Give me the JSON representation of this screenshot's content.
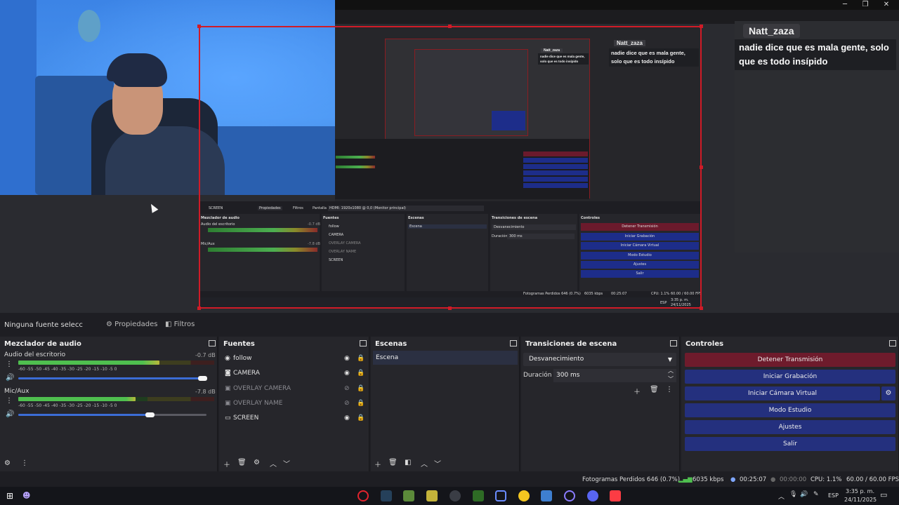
{
  "window_controls": {
    "minimize": "─",
    "restore": "❐",
    "close": "✕"
  },
  "chat": {
    "username": "Natt_zaza",
    "message": "nadie dice que es mala gente, solo que es todo insípido"
  },
  "preview_capture": {
    "sources_title": "SCREEN",
    "props_btn": "Propiedades",
    "filters_btn": "Filtros",
    "display_label": "Pantalla",
    "display_value": "HDMI: 1920x1080 @ 0,0 (Monitor principal)",
    "mixer_title": "Mezclador de audio",
    "desktop_audio": "Audio del escritorio",
    "desktop_db": "-0.7 dB",
    "mic": "Mic/Aux",
    "mic_db": "-7.8 dB",
    "sources_panel": "Fuentes",
    "scenes_panel": "Escenas",
    "scene": "Escena",
    "trans_panel": "Transiciones de escena",
    "trans_value": "Desvanecimiento",
    "duration_label": "Duración",
    "duration_value": "300 ms",
    "controls_panel": "Controles",
    "sources": [
      "follow",
      "CAMERA",
      "OVERLAY CAMERA",
      "OVERLAY NAME",
      "SCREEN"
    ],
    "controls": [
      "Detener Transmisión",
      "Iniciar Grabación",
      "Iniciar Cámara Virtual",
      "Modo Estudio",
      "Ajustes",
      "Salir"
    ],
    "status": "Fotogramas Perdidos 646 (0.7%)",
    "kbps": "6035 kbps",
    "time": "00:25:07",
    "cpu": "CPU: 1.1%",
    "fps": "60.00 / 60.00 FPS",
    "clock": "3:35 p. m.",
    "date": "24/11/2025",
    "lang": "ESP"
  },
  "source_bar": {
    "no_source": "Ninguna fuente seleccionada",
    "properties": "Propiedades",
    "filters": "Filtros"
  },
  "mixer": {
    "title": "Mezclador de audio",
    "tracks": [
      {
        "name": "Audio del escritorio",
        "db": "-0.7 dB",
        "level": 0.72,
        "volume": 0.98
      },
      {
        "name": "Mic/Aux",
        "db": "-7.8 dB",
        "level": 0.6,
        "volume": 0.7
      }
    ],
    "ticks": "-60 -55 -50 -45 -40 -35 -30 -25 -20 -15 -10 -5 0"
  },
  "sources": {
    "title": "Fuentes",
    "items": [
      {
        "label": "follow",
        "visible": true
      },
      {
        "label": "CAMERA",
        "visible": true
      },
      {
        "label": "OVERLAY CAMERA",
        "visible": false
      },
      {
        "label": "OVERLAY NAME",
        "visible": false
      },
      {
        "label": "SCREEN",
        "visible": true
      }
    ]
  },
  "scenes": {
    "title": "Escenas",
    "items": [
      "Escena"
    ]
  },
  "transitions": {
    "title": "Transiciones de escena",
    "selected": "Desvanecimiento",
    "duration_label": "Duración",
    "duration_value": "300 ms"
  },
  "controls": {
    "title": "Controles",
    "stop_stream": "Detener Transmisión",
    "start_recording": "Iniciar Grabación",
    "start_virtual_cam": "Iniciar Cámara Virtual",
    "studio_mode": "Modo Estudio",
    "settings": "Ajustes",
    "exit": "Salir"
  },
  "status": {
    "dropped_frames": "Fotogramas Perdidos 646 (0.7%)",
    "bitrate": "6035 kbps",
    "stream_time": "00:25:07",
    "record_time": "00:00:00",
    "cpu": "CPU: 1.1%",
    "fps": "60.00 / 60.00 FPS"
  },
  "taskbar": {
    "lang": "ESP",
    "time": "3:35 p. m.",
    "date": "24/11/2025"
  },
  "colors": {
    "accent_red": "#d01b27",
    "control_blue": "#24307e",
    "control_red": "#6e1b2c",
    "panel_bg": "#26262b"
  }
}
